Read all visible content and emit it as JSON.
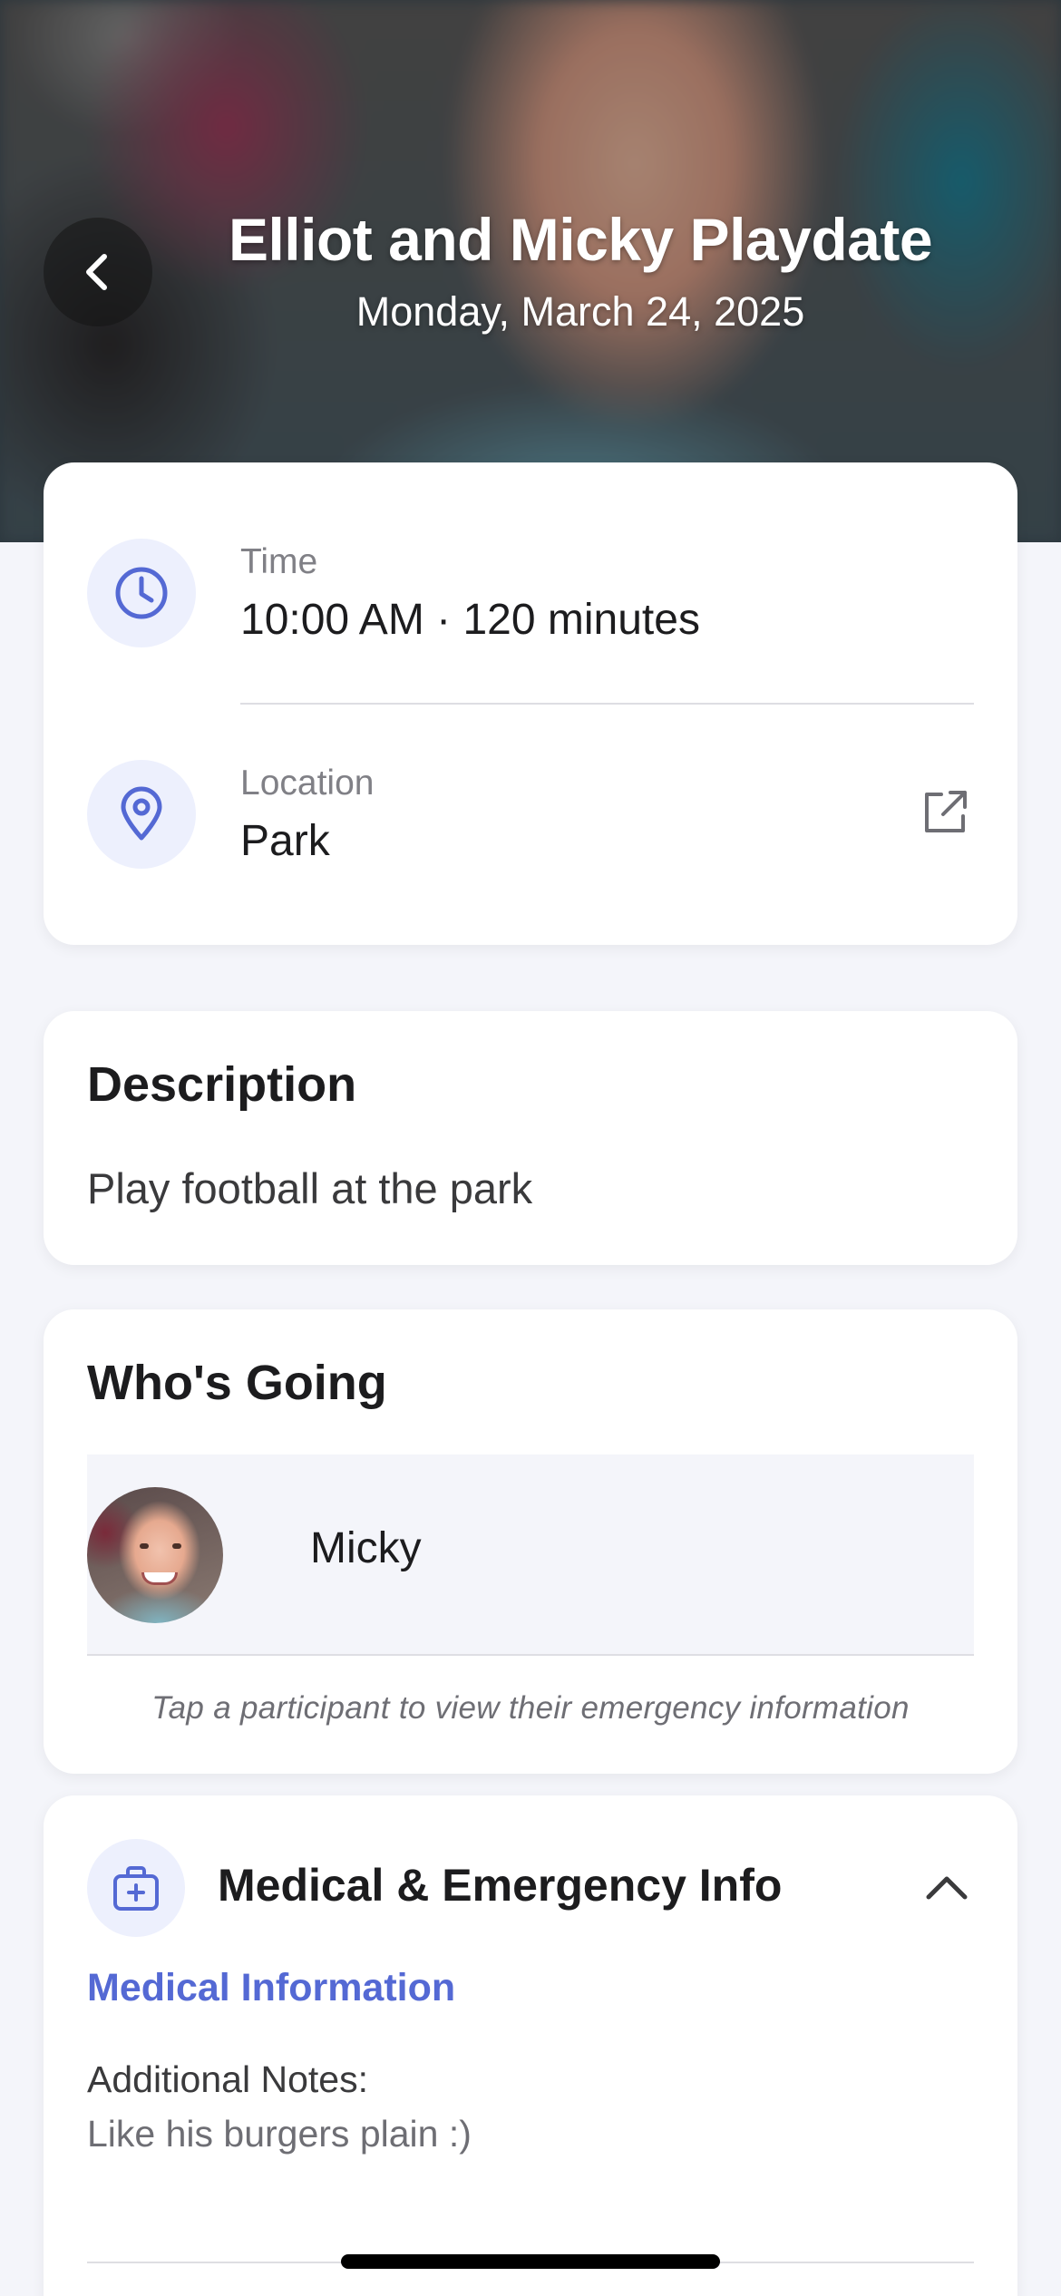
{
  "header": {
    "title": "Elliot and Micky Playdate",
    "date": "Monday, March 24, 2025"
  },
  "details": {
    "time_label": "Time",
    "time_value": "10:00 AM · 120 minutes",
    "location_label": "Location",
    "location_value": "Park"
  },
  "description": {
    "heading": "Description",
    "text": "Play football at the park"
  },
  "whos_going": {
    "heading": "Who's Going",
    "participants": [
      {
        "name": "Micky"
      }
    ],
    "hint": "Tap a participant to view their emergency information"
  },
  "medical": {
    "title": "Medical & Emergency Info",
    "section_link": "Medical Information",
    "notes_label": "Additional Notes:",
    "notes_value": "Like his burgers plain :)"
  },
  "colors": {
    "accent": "#5469d4",
    "icon_bg": "#edf0fd",
    "page_bg": "#f4f5fa"
  },
  "icons": [
    "chevron-left-icon",
    "clock-icon",
    "map-pin-icon",
    "external-link-icon",
    "first-aid-kit-icon",
    "chevron-up-icon"
  ]
}
